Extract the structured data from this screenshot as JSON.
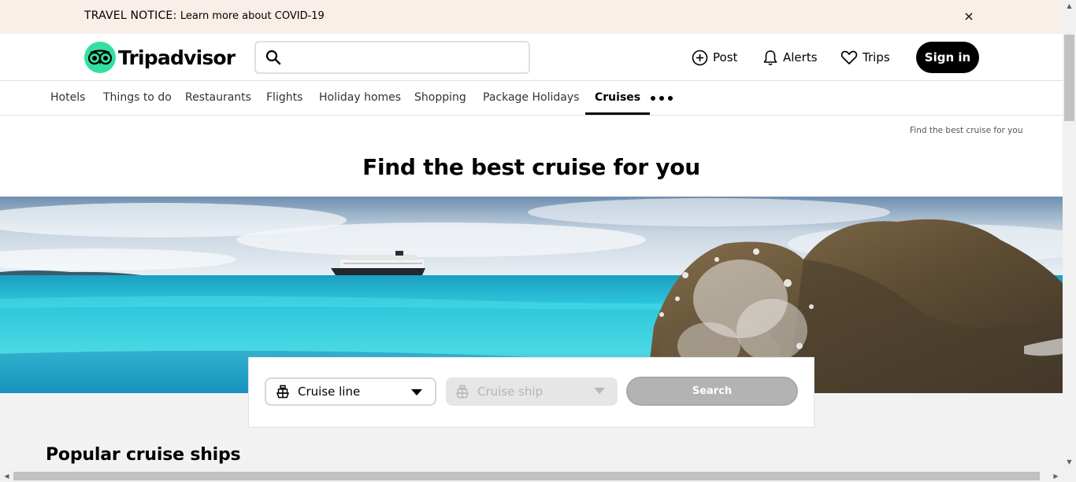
{
  "notice": {
    "label": "TRAVEL NOTICE:",
    "link": "Learn more about COVID-19",
    "close": "×"
  },
  "header": {
    "brand": "Tripadvisor",
    "search": {
      "value": "",
      "placeholder": ""
    },
    "post": "Post",
    "alerts": "Alerts",
    "trips": "Trips",
    "sign_in": "Sign in"
  },
  "tabs": [
    {
      "label": "Hotels"
    },
    {
      "label": "Things to do"
    },
    {
      "label": "Restaurants"
    },
    {
      "label": "Flights"
    },
    {
      "label": "Holiday homes"
    },
    {
      "label": "Shopping"
    },
    {
      "label": "Package Holidays"
    },
    {
      "label": "Cruises",
      "active": true
    }
  ],
  "breadcrumb": "Find the best cruise for you",
  "page_title": "Find the best cruise for you",
  "search_card": {
    "cruise_line": "Cruise line",
    "cruise_ship": "Cruise ship",
    "search_button": "Search"
  },
  "section_title": "Popular cruise ships",
  "colors": {
    "brand_green": "#34e0a1",
    "notice_bg": "#f9eee8",
    "sign_in_bg": "#000000",
    "disabled": "#b3b3b3"
  },
  "icons": [
    "tripadvisor-owl-logo-icon",
    "search-icon",
    "plus-circle-icon",
    "bell-icon",
    "heart-icon",
    "more-dots-icon",
    "ship-icon",
    "chevron-down-icon",
    "close-icon"
  ]
}
